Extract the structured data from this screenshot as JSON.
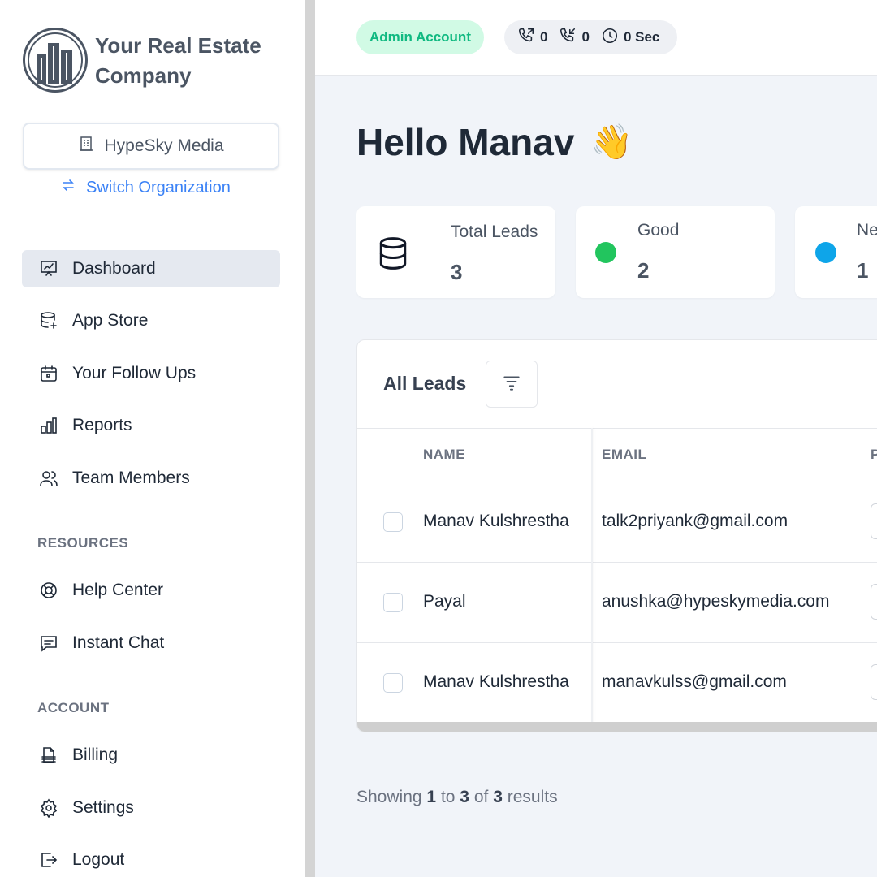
{
  "company": {
    "name_line1": "Your Real Estate",
    "name_line2": "Company"
  },
  "organization": {
    "name": "HypeSky Media",
    "switch_label": "Switch Organization"
  },
  "nav": {
    "main": [
      {
        "label": "Dashboard",
        "icon": "presentation-chart-icon",
        "active": true
      },
      {
        "label": "App Store",
        "icon": "database-plus-icon"
      },
      {
        "label": "Your Follow Ups",
        "icon": "calendar-icon"
      },
      {
        "label": "Reports",
        "icon": "bar-chart-icon"
      },
      {
        "label": "Team Members",
        "icon": "users-icon"
      }
    ],
    "resources_title": "RESOURCES",
    "resources": [
      {
        "label": "Help Center",
        "icon": "lifebuoy-icon"
      },
      {
        "label": "Instant Chat",
        "icon": "chat-icon"
      }
    ],
    "account_title": "ACCOUNT",
    "account": [
      {
        "label": "Billing",
        "icon": "document-icon"
      },
      {
        "label": "Settings",
        "icon": "gear-icon"
      },
      {
        "label": "Logout",
        "icon": "logout-icon"
      }
    ]
  },
  "topbar": {
    "account_badge": "Admin Account",
    "outgoing_calls": "0",
    "incoming_calls": "0",
    "call_time": "0 Sec"
  },
  "greeting": {
    "text": "Hello Manav",
    "emoji": "👋"
  },
  "stats": [
    {
      "label": "Total Leads",
      "value": "3",
      "icon": "database-icon"
    },
    {
      "label": "Good",
      "value": "2",
      "color": "#22c55e"
    },
    {
      "label": "Ne",
      "value": "1",
      "color": "#0ea5e9"
    }
  ],
  "leads_table": {
    "title": "All Leads",
    "columns": [
      "NAME",
      "EMAIL",
      "P"
    ],
    "rows": [
      {
        "name": "Manav Kulshrestha",
        "email": "talk2priyank@gmail.com"
      },
      {
        "name": "Payal",
        "email": "anushka@hypeskymedia.com"
      },
      {
        "name": "Manav Kulshrestha",
        "email": "manavkulss@gmail.com"
      }
    ]
  },
  "pagination": {
    "prefix": "Showing",
    "from": "1",
    "to_word": "to",
    "to": "3",
    "of_word": "of",
    "total": "3",
    "suffix": "results"
  },
  "colors": {
    "accent": "#3b82f6",
    "good": "#22c55e",
    "new": "#0ea5e9",
    "admin_badge_bg": "#d1fae5",
    "admin_badge_text": "#10b981"
  }
}
